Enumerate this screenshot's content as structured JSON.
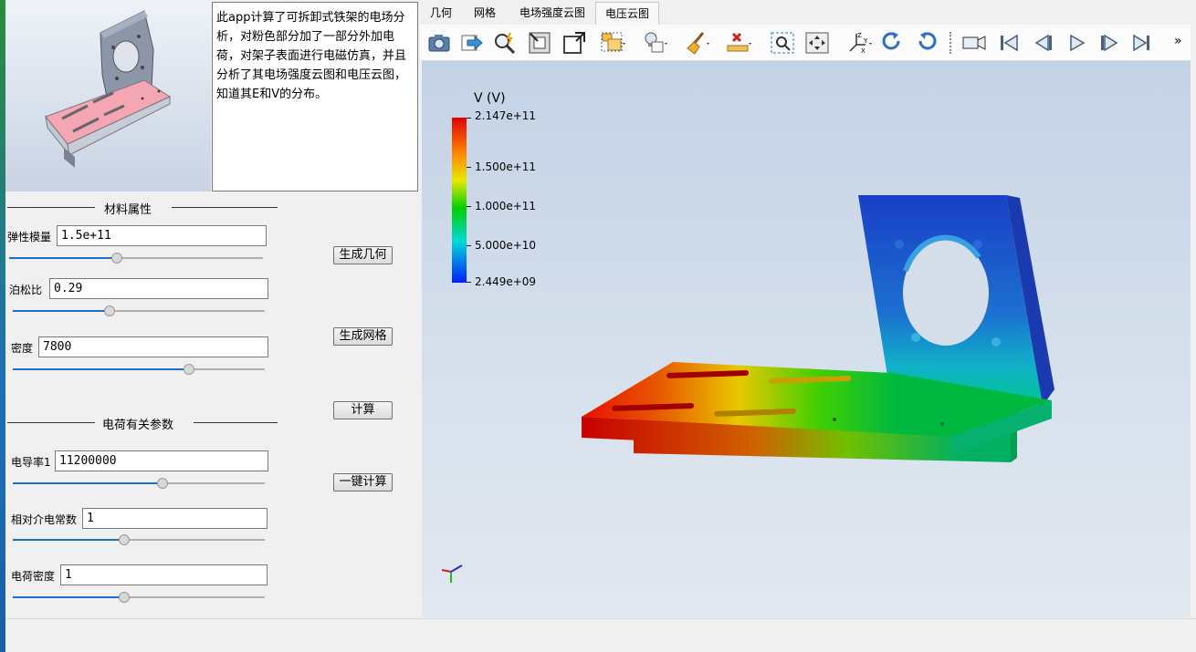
{
  "description": "此app计算了可拆卸式铁架的电场分析，对粉色部分加了一部分外加电荷，对架子表面进行电磁仿真，并且分析了其电场强度云图和电压云图，知道其E和V的分布。",
  "material_group": {
    "title": "材料属性",
    "fields": [
      {
        "label": "弹性模量",
        "value": "1.5e+11",
        "slider_fraction": 0.42
      },
      {
        "label": "泊松比",
        "value": "0.29",
        "slider_fraction": 0.38
      },
      {
        "label": "密度",
        "value": "7800",
        "slider_fraction": 0.71
      }
    ]
  },
  "charge_group": {
    "title": "电荷有关参数",
    "fields": [
      {
        "label": "电导率1",
        "value": "11200000",
        "slider_fraction": 0.6
      },
      {
        "label": "相对介电常数",
        "value": "1",
        "slider_fraction": 0.44
      },
      {
        "label": "电荷密度",
        "value": "1",
        "slider_fraction": 0.44
      }
    ]
  },
  "buttons": {
    "gen_geometry": "生成几何",
    "gen_mesh": "生成网格",
    "compute": "计算",
    "one_click": "一键计算"
  },
  "tabs": [
    "几何",
    "网格",
    "电场强度云图",
    "电压云图"
  ],
  "active_tab": "电压云图",
  "toolbar_icons": [
    "camera-icon",
    "export-arrow-icon",
    "zoom-select-icon",
    "zoom-extents-icon",
    "zoom-box-icon",
    "selection-box-icon",
    "light-bulb-icon",
    "broom-clear-icon",
    "measure-delete-icon",
    "zoom-window-icon",
    "pan-icon",
    "axes-orientation-icon",
    "rotate-cw-icon",
    "rotate-ccw-icon",
    "video-camera-icon",
    "skip-first-icon",
    "step-back-icon",
    "play-icon",
    "step-forward-icon",
    "skip-last-icon"
  ],
  "toolbar_overflow": "»",
  "legend": {
    "title": "V (V)",
    "max_label": "2.147e+11",
    "labels": [
      "1.500e+11",
      "1.000e+11",
      "5.000e+10"
    ],
    "min_label": "2.449e+09"
  },
  "colors": {
    "accent_blue": "#1a6fc8",
    "part_pink": "#f4a6b4",
    "part_gray": "#8c96a8"
  }
}
